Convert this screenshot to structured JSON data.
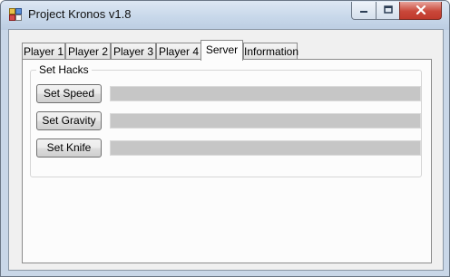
{
  "window": {
    "title": "Project Kronos v1.8",
    "icon": "app-icon",
    "controls": [
      "minimize-icon",
      "maximize-icon",
      "close-icon"
    ]
  },
  "tabs": [
    {
      "label": "Player 1"
    },
    {
      "label": "Player 2"
    },
    {
      "label": "Player 3"
    },
    {
      "label": "Player 4"
    },
    {
      "label": "Server",
      "active": true
    },
    {
      "label": "Information"
    }
  ],
  "server": {
    "group_label": "Set Hacks",
    "rows": [
      {
        "button": "Set Speed",
        "value": ""
      },
      {
        "button": "Set Gravity",
        "value": ""
      },
      {
        "button": "Set Knife",
        "value": ""
      }
    ]
  },
  "colors": {
    "title_bar": "#c8d8ea",
    "close_button": "#c9483a",
    "field_fill": "#c6c6c6"
  }
}
